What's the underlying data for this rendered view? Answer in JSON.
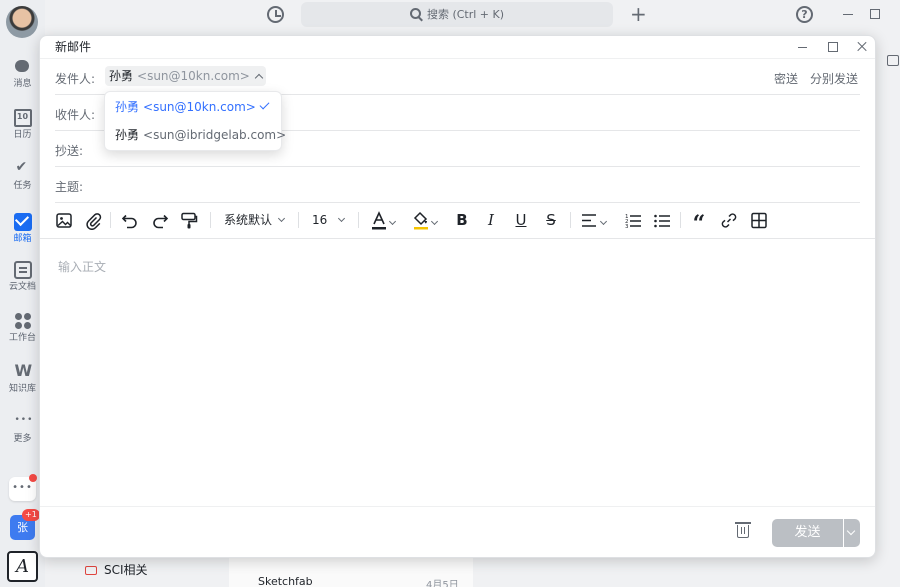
{
  "app": {
    "search_placeholder": "搜索 (Ctrl + K)",
    "nav": [
      {
        "label": "消息",
        "icon": "chat-bubble-icon"
      },
      {
        "label": "日历",
        "icon": "calendar-icon"
      },
      {
        "label": "任务",
        "icon": "task-check-icon"
      },
      {
        "label": "邮箱",
        "icon": "mail-icon",
        "active": true
      },
      {
        "label": "云文档",
        "icon": "cloud-doc-icon"
      },
      {
        "label": "工作台",
        "icon": "workplace-icon"
      },
      {
        "label": "知识库",
        "icon": "wiki-icon"
      },
      {
        "label": "更多",
        "icon": "more-icon"
      }
    ],
    "chat_avatar_text": "张",
    "chat_badge": "+1",
    "accent_color": "#3370ff"
  },
  "background": {
    "folder_label": "SCI相关",
    "mail_sender": "Sketchfab",
    "mail_date": "4月5日"
  },
  "compose": {
    "title": "新邮件",
    "from_label": "发件人:",
    "from_name": "孙勇",
    "from_email": "<sun@10kn.com>",
    "bcc_label": "密送",
    "split_send_label": "分别发送",
    "to_label": "收件人:",
    "cc_label": "抄送:",
    "subject_label": "主题:",
    "font_family": "系统默认",
    "font_size": "16",
    "body_placeholder": "输入正文",
    "send_label": "发送"
  },
  "sender_dropdown": {
    "options": [
      {
        "name": "孙勇",
        "email": "<sun@10kn.com>",
        "selected": true
      },
      {
        "name": "孙勇",
        "email": "<sun@ibridgelab.com>",
        "selected": false
      }
    ]
  }
}
